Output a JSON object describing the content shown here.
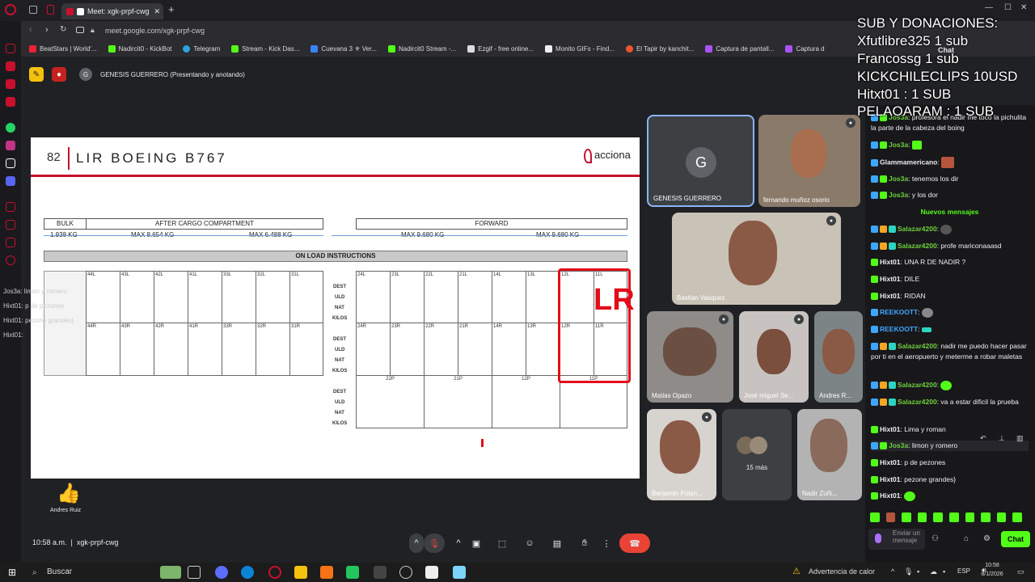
{
  "browser": {
    "tab_title": "Meet: xgk-prpf-cwg",
    "url": "meet.google.com/xgk-prpf-cwg",
    "bookmarks": [
      "BeatStars | World'...",
      "Nadircit0 - KickBot",
      "Telegram",
      "Stream - Kick Das...",
      "Cuevana 3 ⚜ Ver...",
      "Nadircit0 Stream -...",
      "Ezgif - free online...",
      "Monito GIFs - Find...",
      "El Tapir by kanchit...",
      "Captura de pantall...",
      "Captura d"
    ]
  },
  "meet": {
    "presenter_label": "GENESIS GUERRERO (Presentando y anotando)",
    "time": "10:58 a.m.",
    "meeting_code": "xgk-prpf-cwg",
    "reaction_name": "Andres Ruiz",
    "reaction_emoji": "👍"
  },
  "slide": {
    "number": "82",
    "title": "LIR BOEING B767",
    "logo_text": "acciona",
    "sections": {
      "bulk": "BULK",
      "after": "AFTER CARGO COMPARTMENT",
      "forward": "FORWARD",
      "kg_bulk": "1.938 KG",
      "kg_after1": "MAX 8.654 KG",
      "kg_after2": "MAX 6.488 KG",
      "kg_fwd1": "MAX 9.680 KG",
      "kg_fwd2": "MAX 9.680 KG",
      "on_load": "ON LOAD INSTRUCTIONS"
    },
    "row_labels": [
      "DEST",
      "ULD",
      "NAT",
      "KILOS"
    ],
    "aft_top": [
      "44L",
      "43L",
      "42L",
      "41L",
      "33L",
      "32L",
      "31L"
    ],
    "aft_bottom": [
      "44R",
      "43R",
      "42R",
      "41R",
      "33R",
      "32R",
      "31R"
    ],
    "fwd_top": [
      "24L",
      "23L",
      "22L",
      "21L",
      "14L",
      "13L",
      "12L",
      "11L"
    ],
    "fwd_bottom": [
      "24R",
      "23R",
      "22R",
      "21R",
      "14R",
      "13R",
      "12R",
      "11R"
    ],
    "pallets": [
      "22P",
      "21P",
      "12P",
      "11P"
    ],
    "annotation": "LR"
  },
  "participants": [
    {
      "name": "GENESIS GUERRERO",
      "initial": "G"
    },
    {
      "name": "fernando muñoz osorio"
    },
    {
      "name": "Bastian Vasquez"
    },
    {
      "name": "Matias Opazo"
    },
    {
      "name": "José miguel Se..."
    },
    {
      "name": "Andres R..."
    },
    {
      "name": "Benjamin Polan..."
    },
    {
      "name": "15 más"
    },
    {
      "name": "Nadir Zuñi..."
    }
  ],
  "chat": {
    "header": "Chat",
    "new_messages": "Nuevos mensajes",
    "input_placeholder": "Enviar un mensaje",
    "send_label": "Chat",
    "messages": [
      {
        "user": "Jos3a",
        "text": ": profesora el nadir me toco la pichulita la parte de la cabeza del boing",
        "color": "#6fcf3c"
      },
      {
        "user": "Jos3a",
        "text": ":",
        "color": "#6fcf3c"
      },
      {
        "user": "Glammamericano",
        "text": ":",
        "color": "#ffffff"
      },
      {
        "user": "Jos3a",
        "text": ": tenemos los dir",
        "color": "#6fcf3c"
      },
      {
        "user": "Jos3a",
        "text": ": y los dor",
        "color": "#6fcf3c"
      },
      {
        "user": "Salazar4200",
        "text": ":",
        "color": "#6fcf3c"
      },
      {
        "user": "Salazar4200",
        "text": ": profe mariconaaasd",
        "color": "#6fcf3c"
      },
      {
        "user": "Hixt01",
        "text": ": UNA R DE NADIR ?",
        "color": "#ffffff"
      },
      {
        "user": "Hixt01",
        "text": ": DILE",
        "color": "#ffffff"
      },
      {
        "user": "Hixt01",
        "text": ": RIDAN",
        "color": "#ffffff"
      },
      {
        "user": "REEKOOTT",
        "text": ":",
        "color": "#6fcf3c"
      },
      {
        "user": "REEKOOTT",
        "text": ":",
        "color": "#6fcf3c"
      },
      {
        "user": "Salazar4200",
        "text": ": nadir me puedo hacer pasar por ti en el aeropuerto y meterme a robar maletas",
        "color": "#6fcf3c"
      },
      {
        "user": "Salazar4200",
        "text": ":",
        "color": "#6fcf3c"
      },
      {
        "user": "Salazar4200",
        "text": ": va a estar dificil la prueba",
        "color": "#6fcf3c"
      },
      {
        "user": "Hixt01",
        "text": ": Lima y roman",
        "color": "#ffffff"
      },
      {
        "user": "Jos3a",
        "text": ": limon y romero",
        "color": "#6fcf3c"
      },
      {
        "user": "Hixt01",
        "text": ": p de pezones",
        "color": "#ffffff"
      },
      {
        "user": "Hixt01",
        "text": ": pezone grandes}",
        "color": "#ffffff"
      },
      {
        "user": "Hixt01",
        "text": ":",
        "color": "#ffffff"
      }
    ]
  },
  "stream_overlay": {
    "lines": [
      "SUB Y DONACIONES:",
      "Xfutlibre325 1 sub",
      "Francossg 1 sub",
      "KICKCHILECLIPS 10USD",
      "Hitxt01 : 1 SUB",
      "PELAOARAM : 1 SUB"
    ],
    "left_lines": [
      "Jos3a: limon y romero",
      "Hixt01: p de pezones",
      "Hixt01: pezone grandes}",
      "Hixt01:"
    ]
  },
  "taskbar": {
    "search": "Buscar",
    "weather": "Advertencia de calor",
    "lang": "ESP",
    "time": "10:58",
    "date": "8/1/2026"
  }
}
